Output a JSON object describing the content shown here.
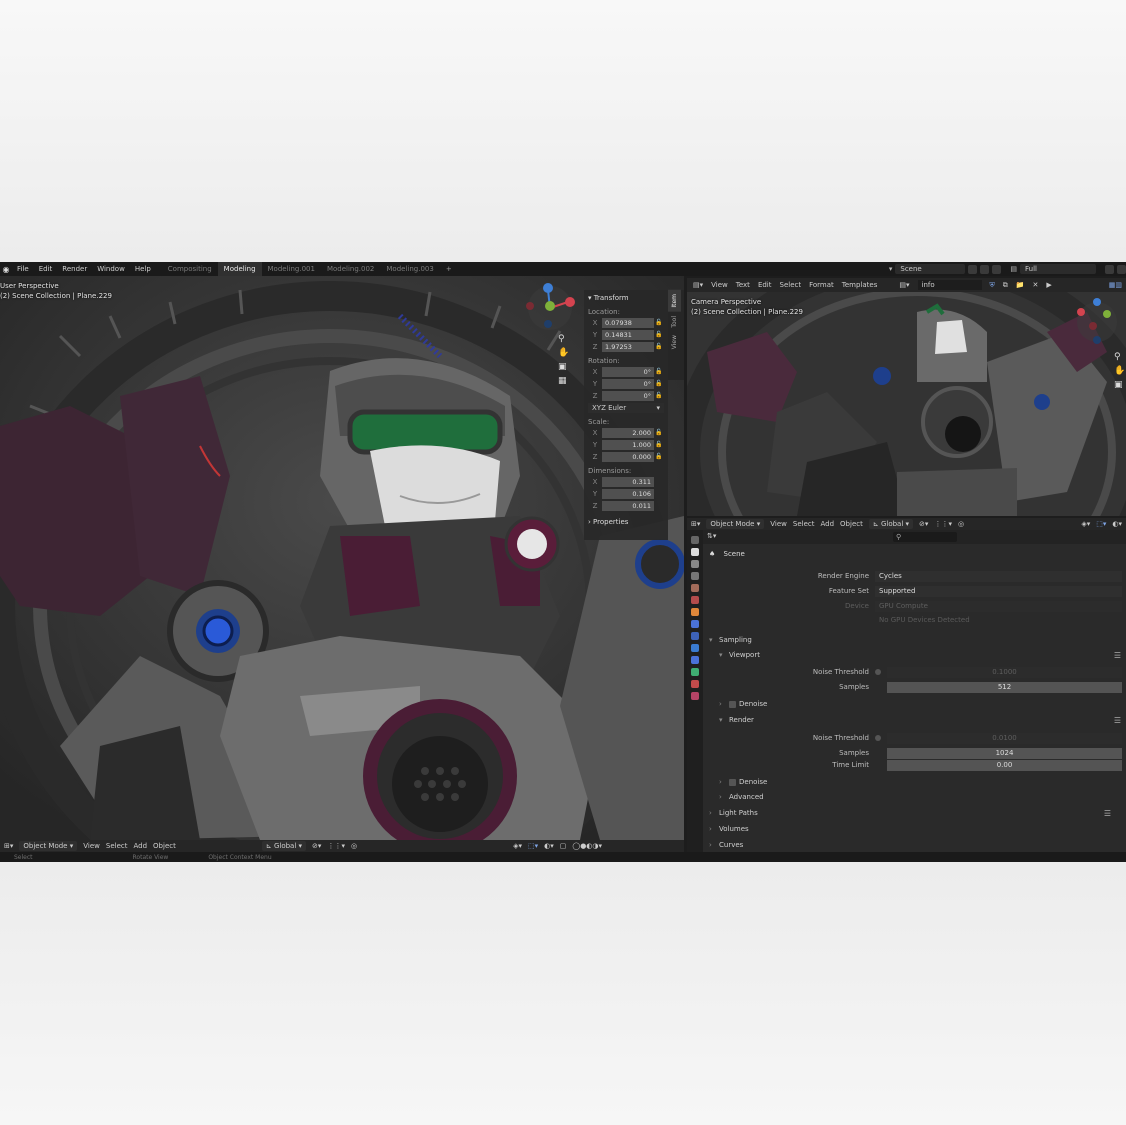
{
  "topbar": {
    "menu": [
      "File",
      "Edit",
      "Render",
      "Window",
      "Help"
    ],
    "workspaces": [
      "Compositing",
      "Modeling",
      "Modeling.001",
      "Modeling.002",
      "Modeling.003"
    ],
    "active_workspace": "Modeling",
    "add_tab": "+",
    "scene_name": "Scene",
    "view_layer": "Full"
  },
  "left_viewport": {
    "perspective_label": "User Perspective",
    "collection_label": "(2) Scene Collection | Plane.229",
    "header": {
      "mode": "Object Mode",
      "menu": [
        "View",
        "Select",
        "Add",
        "Object"
      ],
      "orientation": "Global"
    }
  },
  "npanel": {
    "title": "Transform",
    "tabs": [
      "Item",
      "Tool",
      "View"
    ],
    "location_label": "Location:",
    "location": [
      {
        "axis": "X",
        "value": "0.07938"
      },
      {
        "axis": "Y",
        "value": "0.14831"
      },
      {
        "axis": "Z",
        "value": "1.97253"
      }
    ],
    "rotation_label": "Rotation:",
    "rotation": [
      {
        "axis": "X",
        "value": "0°"
      },
      {
        "axis": "Y",
        "value": "0°"
      },
      {
        "axis": "Z",
        "value": "0°"
      }
    ],
    "rotation_mode": "XYZ Euler",
    "scale_label": "Scale:",
    "scale": [
      {
        "axis": "X",
        "value": "2.000"
      },
      {
        "axis": "Y",
        "value": "1.000"
      },
      {
        "axis": "Z",
        "value": "0.000"
      }
    ],
    "dimensions_label": "Dimensions:",
    "dimensions": [
      {
        "axis": "X",
        "value": "0.311"
      },
      {
        "axis": "Y",
        "value": "0.106"
      },
      {
        "axis": "Z",
        "value": "0.011"
      }
    ],
    "properties_label": "Properties"
  },
  "right_editor": {
    "menu": [
      "View",
      "Text",
      "Edit",
      "Select",
      "Format",
      "Templates"
    ],
    "text_name": "info"
  },
  "right_viewport": {
    "perspective_label": "Camera Perspective",
    "collection_label": "(2) Scene Collection | Plane.229",
    "header": {
      "mode": "Object Mode",
      "menu": [
        "View",
        "Select",
        "Add",
        "Object"
      ],
      "orientation": "Global"
    }
  },
  "properties": {
    "context": "Scene",
    "search_icon": "search-icon",
    "render_engine_label": "Render Engine",
    "render_engine": "Cycles",
    "feature_set_label": "Feature Set",
    "feature_set": "Supported",
    "device_label": "Device",
    "device": "GPU Compute",
    "device_note": "No GPU Devices Detected",
    "sampling": "Sampling",
    "viewport": "Viewport",
    "vp_noise_label": "Noise Threshold",
    "vp_noise": "0.1000",
    "vp_samples_label": "Samples",
    "vp_samples": "512",
    "denoise": "Denoise",
    "render": "Render",
    "r_noise_label": "Noise Threshold",
    "r_noise": "0.0100",
    "r_samples_label": "Samples",
    "r_samples": "1024",
    "time_limit_label": "Time Limit",
    "time_limit": "0.00",
    "denoise2": "Denoise",
    "advanced": "Advanced",
    "light_paths": "Light Paths",
    "volumes": "Volumes",
    "curves": "Curves"
  },
  "statusbar": {
    "items": [
      "Select",
      "Rotate View",
      "Object Context Menu"
    ]
  },
  "colors": {
    "accent_blue": "#4a72d8",
    "gizmo_x": "#d4434f",
    "gizmo_y": "#7fb13a",
    "gizmo_z": "#3e7fd6",
    "visor": "#1f6e3c",
    "magenta": "#5a1e3a"
  }
}
